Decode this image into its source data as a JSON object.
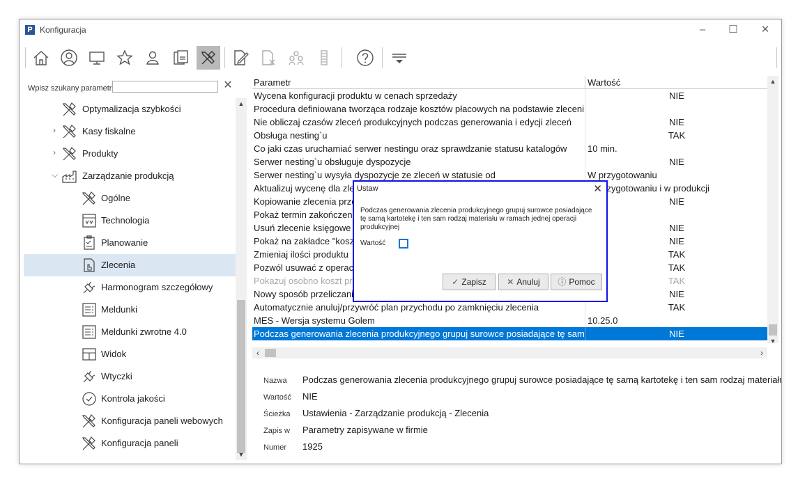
{
  "window": {
    "title": "Konfiguracja",
    "logo_letter": "P",
    "minimize": "–",
    "maximize": "☐",
    "close": "✕"
  },
  "toolbar": {
    "icons": [
      "home-icon",
      "user-circle-icon",
      "monitor-icon",
      "star-icon",
      "person-icon",
      "cards-icon",
      "tools-icon",
      "edit-doc-icon",
      "delete-doc-icon",
      "users-group-icon",
      "list-icon",
      "help-icon",
      "menu-icon"
    ],
    "active": "tools-icon"
  },
  "search": {
    "label": "Wpisz szukany parametr",
    "value": "",
    "clear": "✕"
  },
  "tree": {
    "items": [
      {
        "label": "Optymalizacja szybkości",
        "icon": "tools-icon",
        "caret": ""
      },
      {
        "label": "Kasy fiskalne",
        "icon": "tools-icon",
        "caret": "›"
      },
      {
        "label": "Produkty",
        "icon": "tools-icon",
        "caret": "›"
      },
      {
        "label": "Zarządzanie produkcją",
        "icon": "factory-icon",
        "caret": "⌵"
      },
      {
        "label": "Ogólne",
        "icon": "tools-icon",
        "caret": ""
      },
      {
        "label": "Technologia",
        "icon": "technology-icon",
        "caret": ""
      },
      {
        "label": "Planowanie",
        "icon": "clipboard-icon",
        "caret": ""
      },
      {
        "label": "Zlecenia",
        "icon": "order-doc-icon",
        "caret": ""
      },
      {
        "label": "Harmonogram szczegółowy",
        "icon": "plugin-icon",
        "caret": ""
      },
      {
        "label": "Meldunki",
        "icon": "report-icon",
        "caret": ""
      },
      {
        "label": "Meldunki zwrotne 4.0",
        "icon": "report-icon",
        "caret": ""
      },
      {
        "label": "Widok",
        "icon": "view-icon",
        "caret": ""
      },
      {
        "label": "Wtyczki",
        "icon": "plugin-icon",
        "caret": ""
      },
      {
        "label": "Kontrola jakości",
        "icon": "check-circle-icon",
        "caret": ""
      },
      {
        "label": "Konfiguracja paneli webowych",
        "icon": "tools-icon",
        "caret": ""
      },
      {
        "label": "Konfiguracja paneli",
        "icon": "tools-icon",
        "caret": ""
      }
    ],
    "selected": "Zlecenia"
  },
  "grid": {
    "headers": {
      "param": "Parametr",
      "value": "Wartość"
    },
    "rows": [
      {
        "p": "Wycena konfiguracji produktu w cenach sprzedaży",
        "v": "NIE",
        "align": "center"
      },
      {
        "p": "Procedura definiowana tworząca rodzaje kosztów płacowych na podstawie zlecenia",
        "v": "",
        "align": "left"
      },
      {
        "p": "Nie obliczaj czasów zleceń produkcyjnych podczas generowania i edycji zleceń",
        "v": "NIE",
        "align": "center"
      },
      {
        "p": "Obsługa nesting`u",
        "v": "TAK",
        "align": "center"
      },
      {
        "p": "Co jaki czas uruchamiać serwer nestingu oraz sprawdzanie statusu katalogów",
        "v": "10 min.",
        "align": "left"
      },
      {
        "p": "Serwer nesting`u obsługuje dyspozycje",
        "v": "NIE",
        "align": "center"
      },
      {
        "p": "Serwer nesting`u wysyła dyspozycje ze zleceń w statusie od",
        "v": "W przygotowaniu",
        "align": "left"
      },
      {
        "p": "Aktualizuj wycenę dla zleceń",
        "v": "W przygotowaniu i w produkcji",
        "align": "left"
      },
      {
        "p": "Kopiowanie zlecenia przez",
        "v": "NIE",
        "align": "center"
      },
      {
        "p": "Pokaż termin zakończenia",
        "v": "",
        "align": "center"
      },
      {
        "p": "Usuń zlecenie księgowe",
        "v": "NIE",
        "align": "center"
      },
      {
        "p": "Pokaż na zakładce \"koszty\"",
        "v": "NIE",
        "align": "center"
      },
      {
        "p": "Zmieniaj ilości produktu",
        "v": "TAK",
        "align": "center"
      },
      {
        "p": "Pozwól usuwać z operacji",
        "v": "TAK",
        "align": "center"
      },
      {
        "p": "Pokazuj osobno koszt pracy",
        "v": "TAK",
        "align": "center",
        "disabled": true
      },
      {
        "p": "Nowy sposób przeliczania",
        "v": "NIE",
        "align": "center"
      },
      {
        "p": "Automatycznie anuluj/przywróć plan przychodu po zamknięciu zlecenia",
        "v": "TAK",
        "align": "center"
      },
      {
        "p": "MES - Wersja systemu Golem",
        "v": "10.25.0",
        "align": "left"
      },
      {
        "p": "Podczas generowania zlecenia produkcyjnego grupuj surowce posiadające tę samą kartotekę",
        "v": "NIE",
        "align": "center",
        "selected": true
      }
    ]
  },
  "details": {
    "rows": [
      {
        "label": "Nazwa",
        "value": "Podczas generowania zlecenia produkcyjnego grupuj surowce posiadające tę samą kartotekę i ten sam rodzaj materiału w ramach jednej operacji produkcyjnej"
      },
      {
        "label": "Wartość",
        "value": "NIE"
      },
      {
        "label": "Ścieżka",
        "value": "Ustawienia - Zarządzanie produkcją - Zlecenia"
      },
      {
        "label": "Zapis w",
        "value": "Parametry zapisywane w firmie"
      },
      {
        "label": "Numer",
        "value": "1925"
      }
    ]
  },
  "dialog": {
    "title": "Ustaw",
    "close": "✕",
    "message": "Podczas generowania zlecenia produkcyjnego grupuj surowce posiadające tę samą kartotekę i ten sam rodzaj materiału w ramach jednej operacji produkcyjnej",
    "value_label": "Wartość",
    "checked": false,
    "buttons": {
      "save": "Zapisz",
      "cancel": "Anuluj",
      "help": "Pomoc"
    },
    "accent": "#1010e8"
  }
}
